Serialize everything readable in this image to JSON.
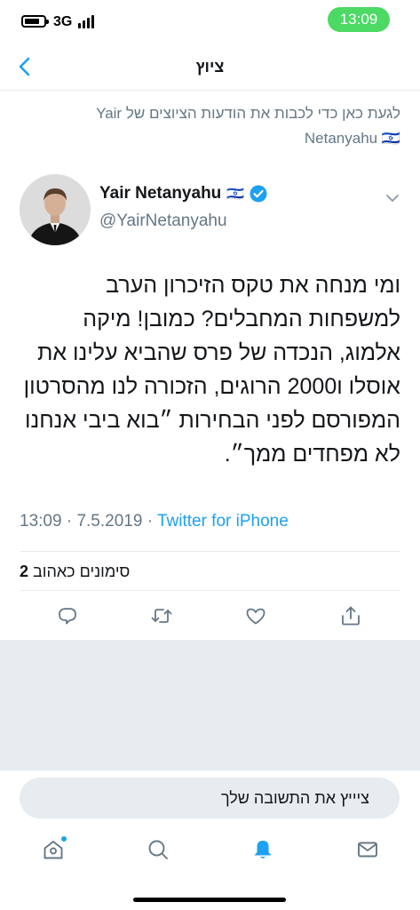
{
  "status_bar": {
    "network": "3G",
    "time": "13:09"
  },
  "nav": {
    "title": "ציוץ"
  },
  "notification_banner": {
    "text": "לגעת כאן כדי לכבות את הודעות הציוצים של Yair Netanyahu 🇮🇱"
  },
  "tweet": {
    "author_name": "Yair Netanyahu",
    "author_flag": "🇮🇱",
    "verified": true,
    "handle": "@YairNetanyahu",
    "text": "ומי מנחה את טקס הזיכרון הערב למשפחות המחבלים? כמובן! מיקה אלמוג, הנכדה של פרס שהביא עלינו את אוסלו ו2000 הרוגים, הזכורה לנו מהסרטון המפורסם לפני הבחירות ״בוא ביבי אנחנו לא מפחדים ממך״.",
    "time": "13:09",
    "date": "7.5.2019",
    "separator": "·",
    "source": "Twitter for iPhone",
    "likes_count": "2",
    "likes_label": "סימונים כאהוב"
  },
  "actions": [
    {
      "icon": "reply-icon"
    },
    {
      "icon": "retweet-icon"
    },
    {
      "icon": "like-icon"
    },
    {
      "icon": "share-icon"
    }
  ],
  "reply": {
    "placeholder": "ציייץ את התשובה שלך"
  },
  "tab_bar": {
    "tabs": [
      {
        "icon": "home-icon",
        "has_badge": true
      },
      {
        "icon": "search-icon",
        "active": false
      },
      {
        "icon": "notifications-icon",
        "active": true
      },
      {
        "icon": "messages-icon",
        "active": false
      }
    ]
  },
  "colors": {
    "accent": "#1da1f2",
    "secondary_text": "#657786",
    "primary_text": "#14171a",
    "divider": "#e6ecf0",
    "time_pill": "#4cd964"
  }
}
